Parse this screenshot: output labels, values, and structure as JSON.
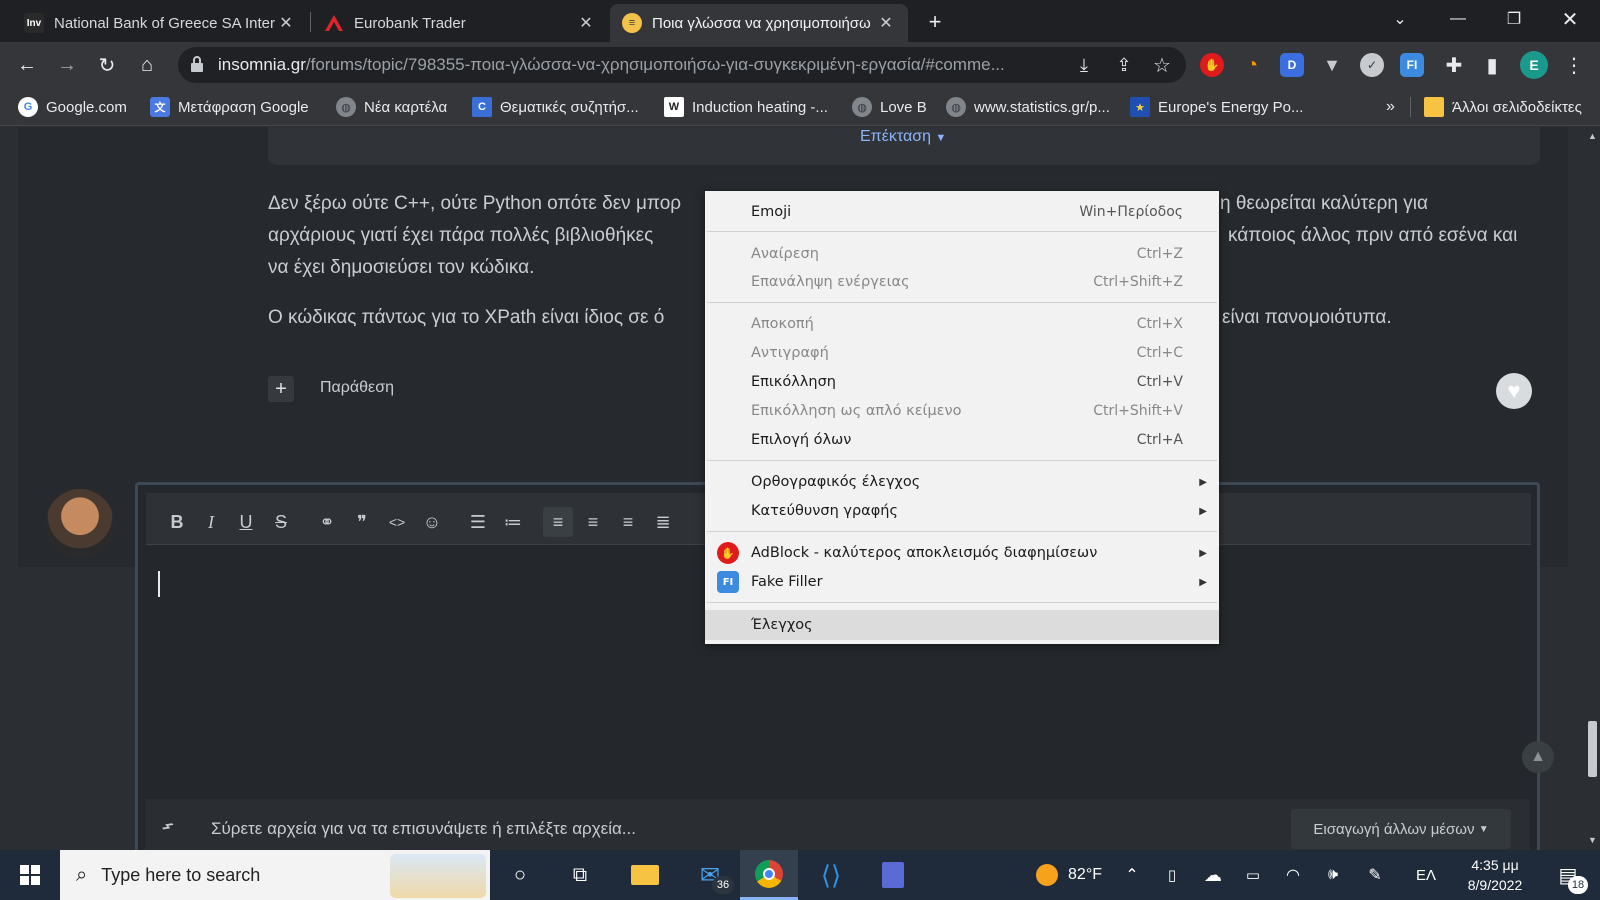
{
  "tabs": [
    {
      "title": "National Bank of Greece SA Inter",
      "icon": "Inv"
    },
    {
      "title": "Eurobank Trader",
      "icon": ""
    },
    {
      "title": "Ποια γλώσσα να χρησιμοποιήσω",
      "icon": ""
    }
  ],
  "address": {
    "host": "insomnia.gr",
    "path": "/forums/topic/798355-ποια-γλώσσα-να-χρησιμοποιήσω-για-συγκεκριμένη-εργασία/#comme..."
  },
  "profile_initial": "E",
  "extensions": {
    "dict": "D",
    "fakefiller": "FI"
  },
  "bookmarks": [
    {
      "label": "Google.com"
    },
    {
      "label": "Μετάφραση Google"
    },
    {
      "label": "Νέα καρτέλα"
    },
    {
      "label": "Θεματικές συζητήσ...",
      "icon": "C"
    },
    {
      "label": "Induction heating -...",
      "icon": "W"
    },
    {
      "label": "Love B"
    },
    {
      "label": "www.statistics.gr/p..."
    },
    {
      "label": "Europe's Energy Po..."
    }
  ],
  "bookmarks_more": "»",
  "other_bookmarks": "Άλλοι σελιδοδείκτες",
  "post": {
    "expand_label": "Επέκταση",
    "line1_left": "Δεν ξέρω ούτε C++, ούτε Python οπότε δεν μπορ",
    "line1_right": "η θεωρείται καλύτερη για",
    "line2_left": "αρχάριους γιατί έχει πάρα πολλές βιβλιοθήκες",
    "line2_right": "κάποιος άλλος πριν από εσένα και",
    "line3": "να έχει δημοσιεύσει τον κώδικα.",
    "line4_left": "Ο κώδικας πάντως για το XPath είναι ίδιος σε ό",
    "line4_right": "είναι πανομοιότυπα.",
    "quote_label": "Παράθεση"
  },
  "editor": {
    "bold": "B",
    "italic": "I",
    "underline": "U",
    "strike": "S",
    "drop_text": "Σύρετε αρχεία για να τα επισυνάψετε ή επιλέξτε αρχεία...",
    "insert_media": "Εισαγωγή άλλων μέσων"
  },
  "context_menu": [
    {
      "label": "Emoji",
      "shortcut": "Win+Περίοδος",
      "disabled": false
    },
    {
      "label": "Αναίρεση",
      "shortcut": "Ctrl+Z",
      "disabled": true
    },
    {
      "label": "Επανάληψη ενέργειας",
      "shortcut": "Ctrl+Shift+Z",
      "disabled": true
    },
    {
      "label": "Αποκοπή",
      "shortcut": "Ctrl+X",
      "disabled": true
    },
    {
      "label": "Αντιγραφή",
      "shortcut": "Ctrl+C",
      "disabled": true
    },
    {
      "label": "Επικόλληση",
      "shortcut": "Ctrl+V",
      "disabled": false
    },
    {
      "label": "Επικόλληση ως απλό κείμενο",
      "shortcut": "Ctrl+Shift+V",
      "disabled": true
    },
    {
      "label": "Επιλογή όλων",
      "shortcut": "Ctrl+A",
      "disabled": false
    },
    {
      "label": "Ορθογραφικός έλεγχος",
      "submenu": true
    },
    {
      "label": "Κατεύθυνση γραφής",
      "submenu": true
    },
    {
      "label": "AdBlock - καλύτερος αποκλεισμός διαφημίσεων",
      "submenu": true
    },
    {
      "label": "Fake Filler",
      "submenu": true
    },
    {
      "label": "Έλεγχος",
      "highlighted": true
    }
  ],
  "taskbar": {
    "search_placeholder": "Type here to search",
    "mail_badge": "36",
    "weather": "82°F",
    "language": "ΕΛ",
    "time": "4:35 μμ",
    "date": "8/9/2022",
    "notifications": "18"
  },
  "colors": {
    "accent_blue": "#8ab4f8",
    "adblock_red": "#e01b1b",
    "vscode_blue": "#2f8fe0"
  }
}
